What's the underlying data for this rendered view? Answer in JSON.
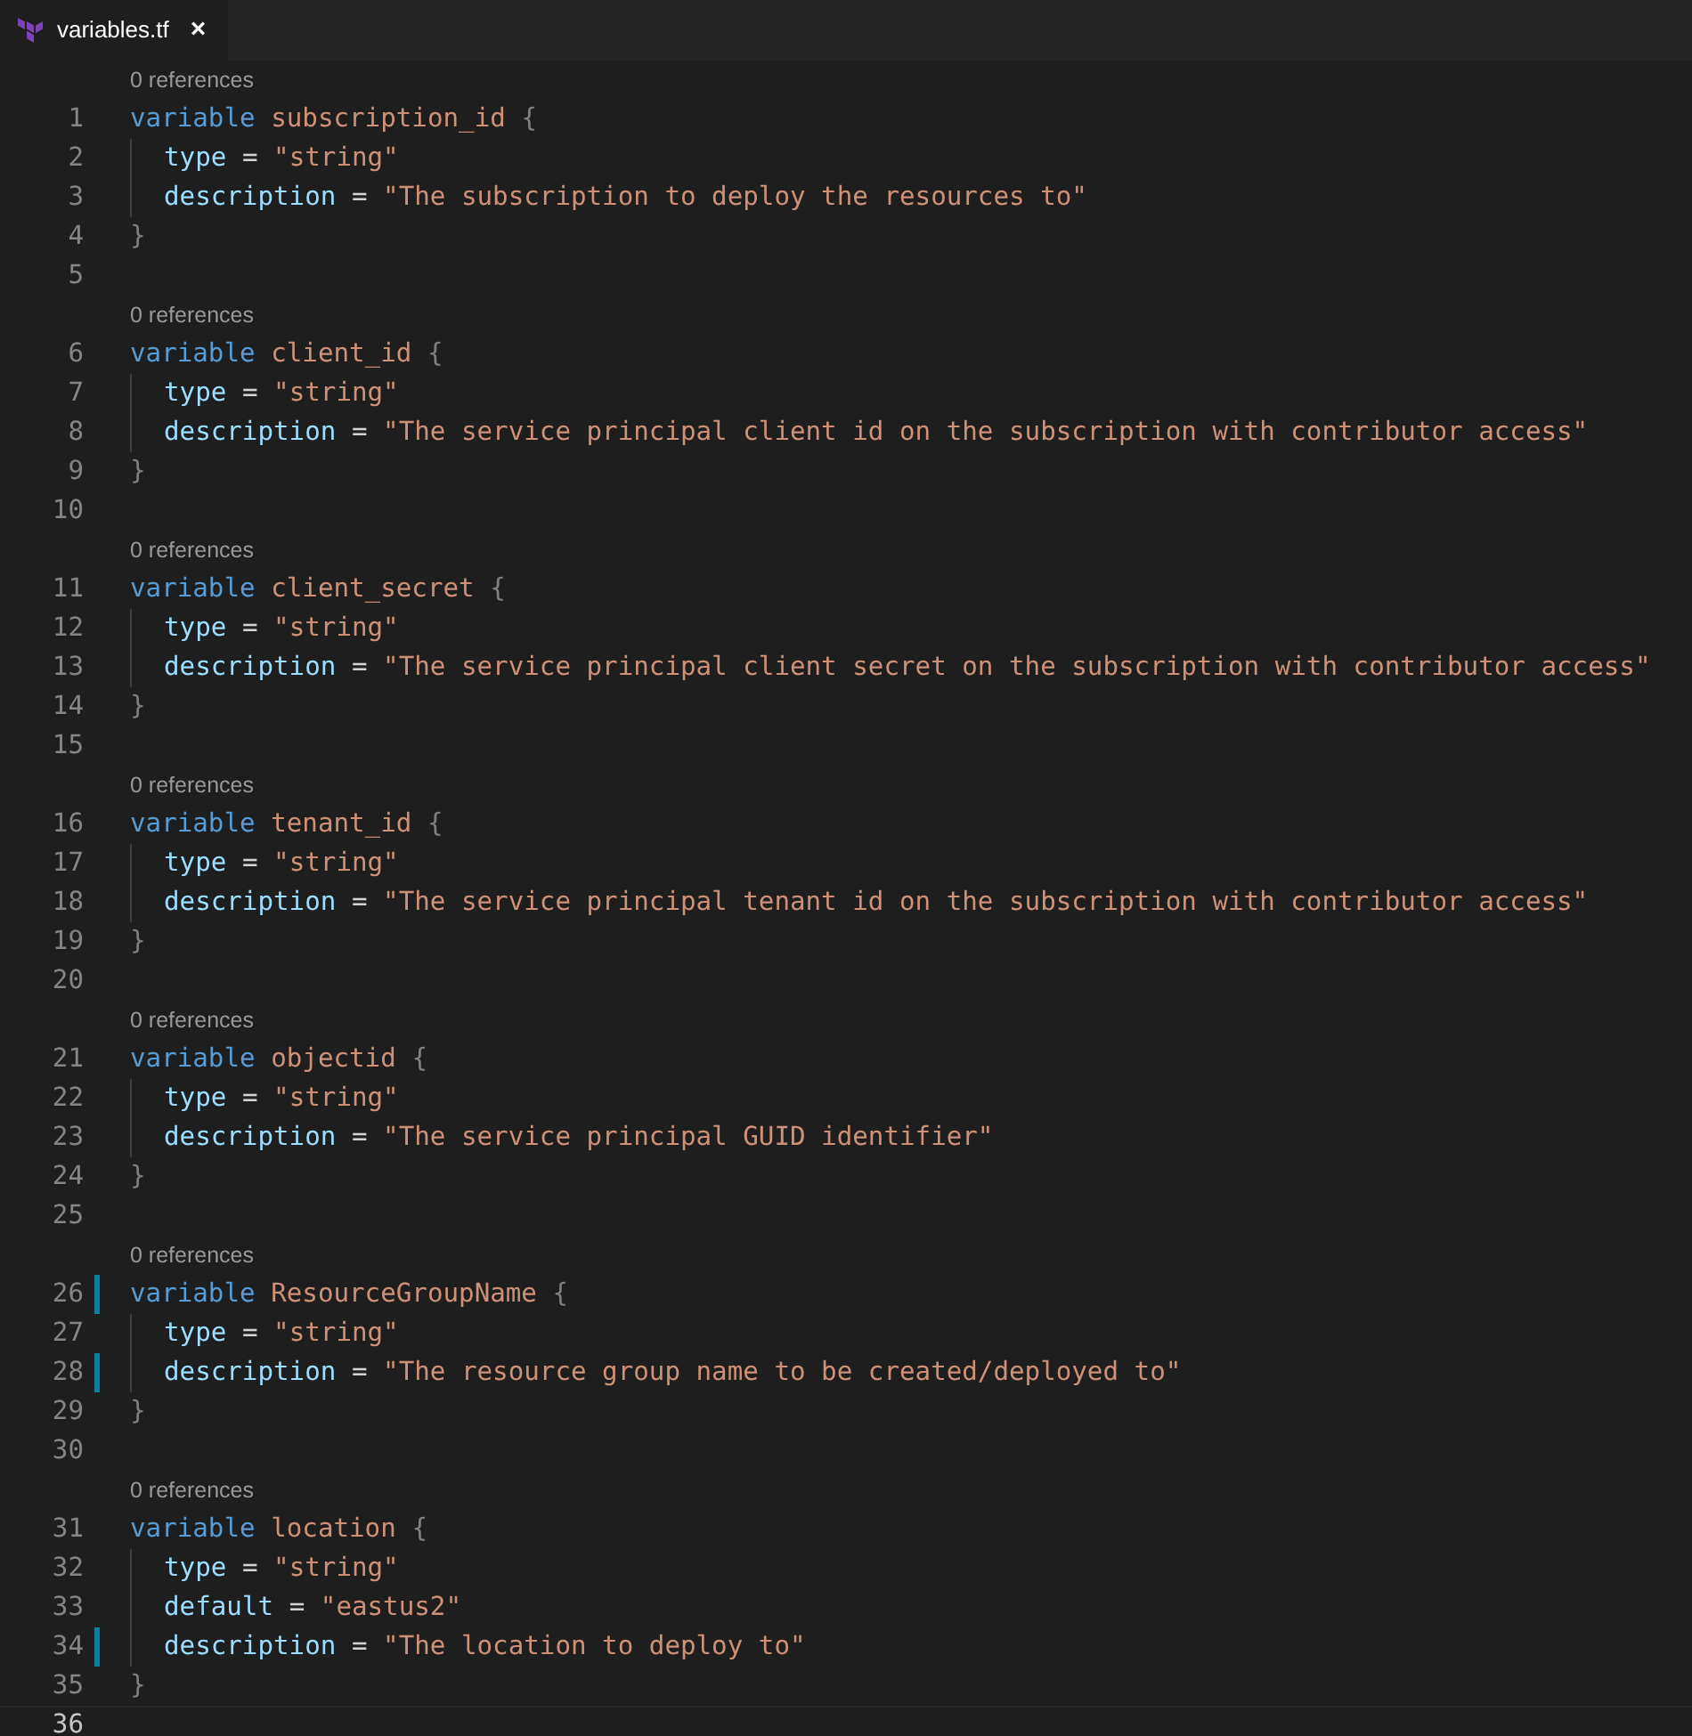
{
  "tab": {
    "title": "variables.tf",
    "close": "×",
    "selected": true
  },
  "lines": [
    {
      "kind": "lens",
      "text": "0 references"
    },
    {
      "kind": "open",
      "number": "1",
      "keyword": "variable",
      "name": "subscription_id",
      "brace": "{",
      "modified": false,
      "current": false
    },
    {
      "kind": "attr",
      "number": "2",
      "key": "type",
      "op": "=",
      "value": "\"string\"",
      "modified": false,
      "current": false
    },
    {
      "kind": "attr",
      "number": "3",
      "key": "description",
      "op": "=",
      "value": "\"The subscription to deploy the resources to\"",
      "modified": false,
      "current": false
    },
    {
      "kind": "close",
      "number": "4",
      "brace": "}",
      "modified": false,
      "current": false
    },
    {
      "kind": "blank",
      "number": "5",
      "modified": false,
      "current": false
    },
    {
      "kind": "lens",
      "text": "0 references"
    },
    {
      "kind": "open",
      "number": "6",
      "keyword": "variable",
      "name": "client_id",
      "brace": "{",
      "modified": false,
      "current": false
    },
    {
      "kind": "attr",
      "number": "7",
      "key": "type",
      "op": "=",
      "value": "\"string\"",
      "modified": false,
      "current": false
    },
    {
      "kind": "attr",
      "number": "8",
      "key": "description",
      "op": "=",
      "value": "\"The service principal client id on the subscription with contributor access\"",
      "modified": false,
      "current": false
    },
    {
      "kind": "close",
      "number": "9",
      "brace": "}",
      "modified": false,
      "current": false
    },
    {
      "kind": "blank",
      "number": "10",
      "modified": false,
      "current": false
    },
    {
      "kind": "lens",
      "text": "0 references"
    },
    {
      "kind": "open",
      "number": "11",
      "keyword": "variable",
      "name": "client_secret",
      "brace": "{",
      "modified": false,
      "current": false
    },
    {
      "kind": "attr",
      "number": "12",
      "key": "type",
      "op": "=",
      "value": "\"string\"",
      "modified": false,
      "current": false
    },
    {
      "kind": "attr",
      "number": "13",
      "key": "description",
      "op": "=",
      "value": "\"The service principal client secret on the subscription with contributor access\"",
      "modified": false,
      "current": false
    },
    {
      "kind": "close",
      "number": "14",
      "brace": "}",
      "modified": false,
      "current": false
    },
    {
      "kind": "blank",
      "number": "15",
      "modified": false,
      "current": false
    },
    {
      "kind": "lens",
      "text": "0 references"
    },
    {
      "kind": "open",
      "number": "16",
      "keyword": "variable",
      "name": "tenant_id",
      "brace": "{",
      "modified": false,
      "current": false
    },
    {
      "kind": "attr",
      "number": "17",
      "key": "type",
      "op": "=",
      "value": "\"string\"",
      "modified": false,
      "current": false
    },
    {
      "kind": "attr",
      "number": "18",
      "key": "description",
      "op": "=",
      "value": "\"The service principal tenant id on the subscription with contributor access\"",
      "modified": false,
      "current": false
    },
    {
      "kind": "close",
      "number": "19",
      "brace": "}",
      "modified": false,
      "current": false
    },
    {
      "kind": "blank",
      "number": "20",
      "modified": false,
      "current": false
    },
    {
      "kind": "lens",
      "text": "0 references"
    },
    {
      "kind": "open",
      "number": "21",
      "keyword": "variable",
      "name": "objectid",
      "brace": "{",
      "modified": false,
      "current": false
    },
    {
      "kind": "attr",
      "number": "22",
      "key": "type",
      "op": "=",
      "value": "\"string\"",
      "modified": false,
      "current": false
    },
    {
      "kind": "attr",
      "number": "23",
      "key": "description",
      "op": "=",
      "value": "\"The service principal GUID identifier\"",
      "modified": false,
      "current": false
    },
    {
      "kind": "close",
      "number": "24",
      "brace": "}",
      "modified": false,
      "current": false
    },
    {
      "kind": "blank",
      "number": "25",
      "modified": false,
      "current": false
    },
    {
      "kind": "lens",
      "text": "0 references"
    },
    {
      "kind": "open",
      "number": "26",
      "keyword": "variable",
      "name": "ResourceGroupName",
      "brace": "{",
      "modified": true,
      "current": false
    },
    {
      "kind": "attr",
      "number": "27",
      "key": "type",
      "op": "=",
      "value": "\"string\"",
      "modified": false,
      "current": false
    },
    {
      "kind": "attr",
      "number": "28",
      "key": "description",
      "op": "=",
      "value": "\"The resource group name to be created/deployed to\"",
      "modified": true,
      "current": false
    },
    {
      "kind": "close",
      "number": "29",
      "brace": "}",
      "modified": false,
      "current": false
    },
    {
      "kind": "blank",
      "number": "30",
      "modified": false,
      "current": false
    },
    {
      "kind": "lens",
      "text": "0 references"
    },
    {
      "kind": "open",
      "number": "31",
      "keyword": "variable",
      "name": "location",
      "brace": "{",
      "modified": false,
      "current": false
    },
    {
      "kind": "attr",
      "number": "32",
      "key": "type",
      "op": "=",
      "value": "\"string\"",
      "modified": false,
      "current": false
    },
    {
      "kind": "attr",
      "number": "33",
      "key": "default",
      "op": "=",
      "value": "\"eastus2\"",
      "modified": false,
      "current": false
    },
    {
      "kind": "attr",
      "number": "34",
      "key": "description",
      "op": "=",
      "value": "\"The location to deploy to\"",
      "modified": true,
      "current": false
    },
    {
      "kind": "close",
      "number": "35",
      "brace": "}",
      "modified": false,
      "current": false
    },
    {
      "kind": "blank",
      "number": "36",
      "modified": false,
      "current": true
    }
  ]
}
